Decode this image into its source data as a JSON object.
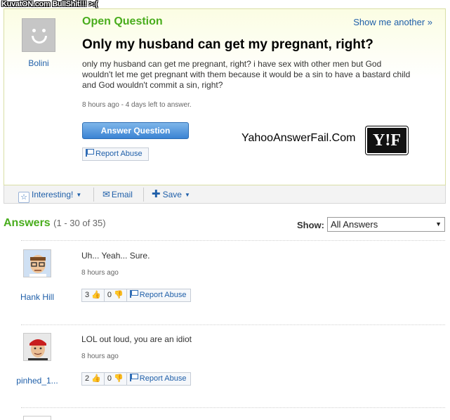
{
  "watermark": "KuvatON.com BullShit!!! >:(",
  "question": {
    "status": "Open Question",
    "show_another": "Show me another »",
    "asker": "Bolini",
    "title": "Only my husband can get my pregnant, right?",
    "body": "only my husband can get me pregnant, right? i have sex with other men but God wouldn't let me get pregnant with them because it would be a sin to have a bastard child and God wouldn't commit a sin, right?",
    "meta": "8 hours ago - 4 days left to answer.",
    "answer_button": "Answer Question",
    "report_label": "Report Abuse",
    "site_text": "YahooAnswerFail.Com",
    "logo_text": "Y!F"
  },
  "toolbar": {
    "interesting": "Interesting!",
    "email": "Email",
    "save": "Save"
  },
  "answers_section": {
    "title": "Answers",
    "range": "(1 - 30 of 35)",
    "show_label": "Show:",
    "filter_value": "All Answers"
  },
  "answers": [
    {
      "user": "Hank Hill",
      "text": "Uh... Yeah... Sure.",
      "meta": "8 hours ago",
      "thumbs_up": "3",
      "thumbs_down": "0",
      "report": "Report Abuse"
    },
    {
      "user": "pinhed_1...",
      "text": "LOL out loud, you are an idiot",
      "meta": "8 hours ago",
      "thumbs_up": "2",
      "thumbs_down": "0",
      "report": "Report Abuse"
    }
  ],
  "colors": {
    "green": "#49ad1d",
    "link": "#1f5fa9",
    "button_blue": "#3a83d3"
  }
}
